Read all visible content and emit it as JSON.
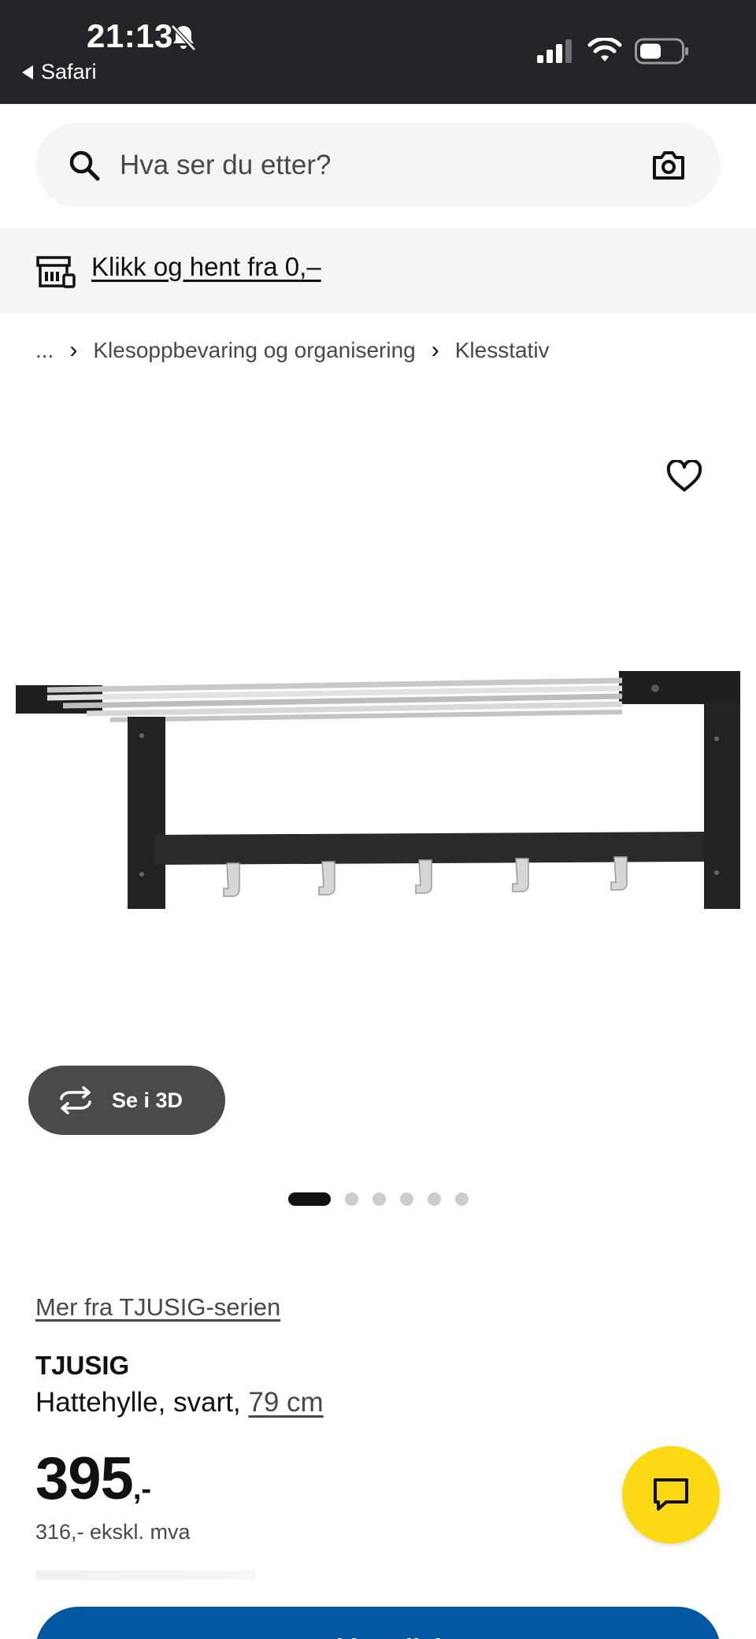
{
  "status_bar": {
    "time": "21:13",
    "back_app": "Safari",
    "icons": [
      "bell-slash-icon",
      "cellular-signal-icon",
      "wifi-icon",
      "battery-icon"
    ]
  },
  "search": {
    "placeholder": "Hva ser du etter?",
    "icons": [
      "search-icon",
      "camera-icon"
    ]
  },
  "banner": {
    "text": "Klikk og hent fra 0,–",
    "icon": "store-icon"
  },
  "breadcrumb": {
    "items": [
      "...",
      "Klesoppbevaring og organisering",
      "Klesstativ"
    ]
  },
  "gallery": {
    "button_3d": "Se i 3D",
    "image_count": 6,
    "active_index": 0
  },
  "product": {
    "series_link": "Mer fra TJUSIG-serien",
    "name": "TJUSIG",
    "description": "Hattehylle, svart,",
    "size": "79 cm",
    "price": "395",
    "price_suffix": ",-",
    "price_ex_vat": "316,- ekskl. mva"
  },
  "cta": {
    "add_to_cart": "Legg i handlekurv"
  },
  "colors": {
    "status_bar": "#232428",
    "chat_button": "#fbd914",
    "primary": "#0058a3",
    "btn_3d": "#4a4a4a"
  }
}
